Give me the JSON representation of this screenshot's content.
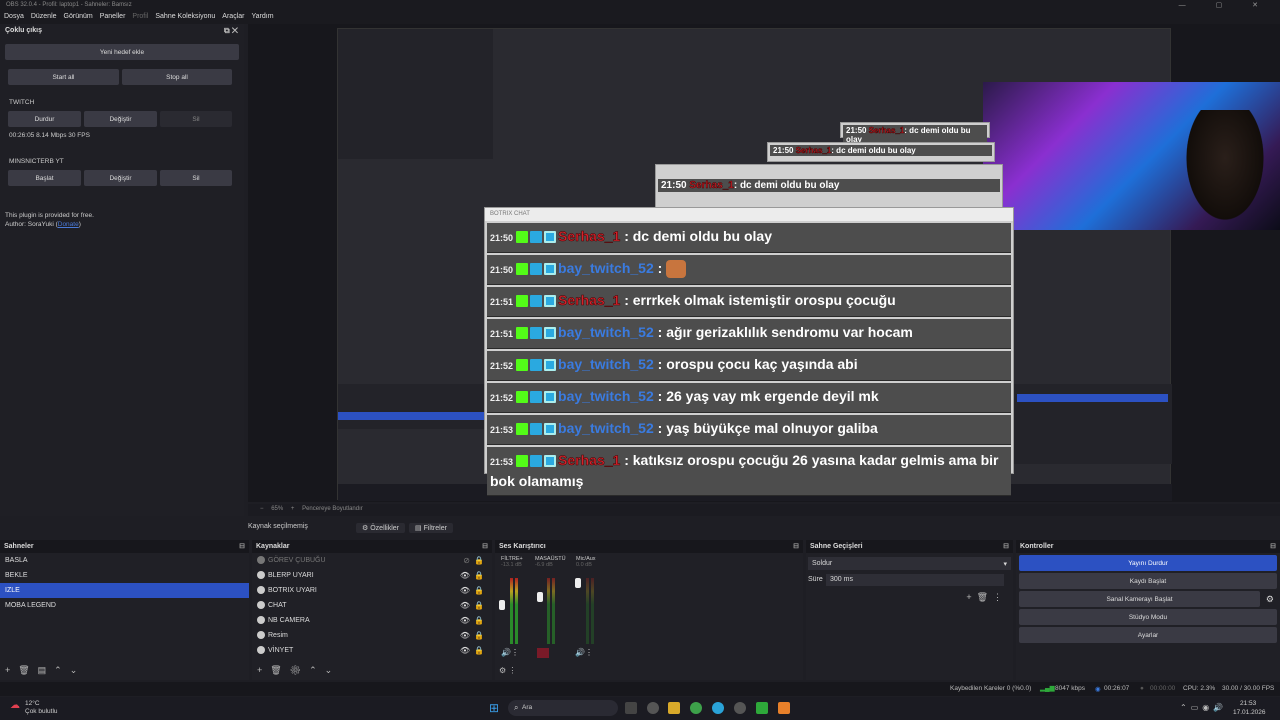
{
  "window": {
    "title": "OBS 32.0.4 - Profil: laptop1 - Sahneler: Bamsız",
    "controls": "— ▢ ✕"
  },
  "menu": [
    "Dosya",
    "Düzenle",
    "Görünüm",
    "Paneller",
    "Profil",
    "Sahne Koleksiyonu",
    "Araçlar",
    "Yardım"
  ],
  "multi_output": {
    "title": "Çoklu çıkış",
    "new_target": "Yeni hedef ekle",
    "start_all": "Start all",
    "stop_all": "Stop all",
    "twitch": {
      "name": "TWITCH",
      "stop": "Durdur",
      "edit": "Değiştir",
      "delete": "Sil",
      "stats": "00:26:05  8.14 Mbps  30 FPS"
    },
    "youtube": {
      "name": "MINSNICTERB YT",
      "start": "Başlat",
      "edit": "Değiştir",
      "delete": "Sil"
    },
    "free_note": "This plugin is provided for free.",
    "author_prefix": "Author: SoraYuki (",
    "author_link": "Donate",
    "author_suffix": ")"
  },
  "chat": {
    "title": "BOTRIX CHAT",
    "messages": [
      {
        "time": "21:50",
        "user": "Serhas_1",
        "color": "red",
        "text": ": dc demi oldu bu olay"
      },
      {
        "time": "21:50",
        "user": "bay_twitch_52",
        "color": "blue",
        "text": ":",
        "emote": true
      },
      {
        "time": "21:51",
        "user": "Serhas_1",
        "color": "red",
        "text": ": errrkek olmak istemiştir orospu çocuğu"
      },
      {
        "time": "21:51",
        "user": "bay_twitch_52",
        "color": "blue",
        "text": ": ağır gerizaklılık sendromu var hocam"
      },
      {
        "time": "21:52",
        "user": "bay_twitch_52",
        "color": "blue",
        "text": ": orospu çocu kaç yaşında abi"
      },
      {
        "time": "21:52",
        "user": "bay_twitch_52",
        "color": "blue",
        "text": ": 26 yaş vay mk ergende deyil mk"
      },
      {
        "time": "21:53",
        "user": "bay_twitch_52",
        "color": "blue",
        "text": ": yaş büyükçe mal olnuyor galiba"
      },
      {
        "time": "21:53",
        "user": "Serhas_1",
        "color": "red",
        "text": ": katıksız orospu çocuğu 26 yasına kadar gelmis ama bir bok olamamış"
      }
    ],
    "echo": [
      {
        "time": "21:50",
        "user": "Serhas_1",
        "text": ": dc demi oldu bu olay"
      },
      {
        "time": "21:50",
        "user": "Serhas_1",
        "text": ": dc demi oldu bu olay"
      },
      {
        "time": "21:50",
        "user": "Serhas_1",
        "text": ": dc demi oldu bu olay"
      }
    ]
  },
  "preview_bar": {
    "zoom": "65%",
    "fit": "Pencereye Boyutlandır"
  },
  "source_bar": {
    "none": "Kaynak seçilmemiş",
    "properties": "Özellikler",
    "filters": "Filtreler"
  },
  "scenes": {
    "title": "Sahneler",
    "items": [
      "BASLA",
      "BEKLE",
      "IZLE",
      "MOBA LEGEND"
    ],
    "selected": 2
  },
  "sources": {
    "title": "Kaynaklar",
    "items": [
      "GÖREV ÇUBUĞU",
      "BLERP UYARI",
      "BOTRIX UYARI",
      "CHAT",
      "NB CAMERA",
      "Resim",
      "VİNYET"
    ]
  },
  "mixer": {
    "title": "Ses Karıştırıcı",
    "channels": [
      {
        "name": "FİLTRE+",
        "db": "-13.1 dB"
      },
      {
        "name": "MASAÜSTÜ",
        "db": "-6.9 dB"
      },
      {
        "name": "Mic/Aux",
        "db": "0.0 dB"
      }
    ],
    "scale": [
      "0",
      "-5",
      "-10",
      "-15",
      "-20",
      "-25",
      "-30",
      "-35",
      "-40",
      "-45",
      "-50",
      "-55",
      "-60"
    ]
  },
  "transitions": {
    "title": "Sahne Geçişleri",
    "type": "Soldur",
    "duration_label": "Süre",
    "duration": "300 ms"
  },
  "controls": {
    "title": "Kontroller",
    "stop_stream": "Yayını Durdur",
    "start_record": "Kaydı Başlat",
    "virtual_cam": "Sanal Kamerayı Başlat",
    "studio": "Stüdyo Modu",
    "settings": "Ayarlar"
  },
  "status": {
    "dropped": "Kaybedilen Kareler 0 (%0.0)",
    "kbps": "8047 kbps",
    "stream_time": "00:26:07",
    "rec_time": "00:00:00",
    "cpu": "CPU: 2.3%",
    "fps": "30.00 / 30.00 FPS"
  },
  "taskbar": {
    "weather_temp": "12°C",
    "weather_desc": "Çok bulutlu",
    "search": "Ara",
    "time": "21:53",
    "date": "17.01.2026"
  },
  "colors": {
    "accent": "#2c51c2",
    "user_red": "#d6222b",
    "user_blue": "#3a7be0",
    "kick_green": "#53fc18"
  }
}
